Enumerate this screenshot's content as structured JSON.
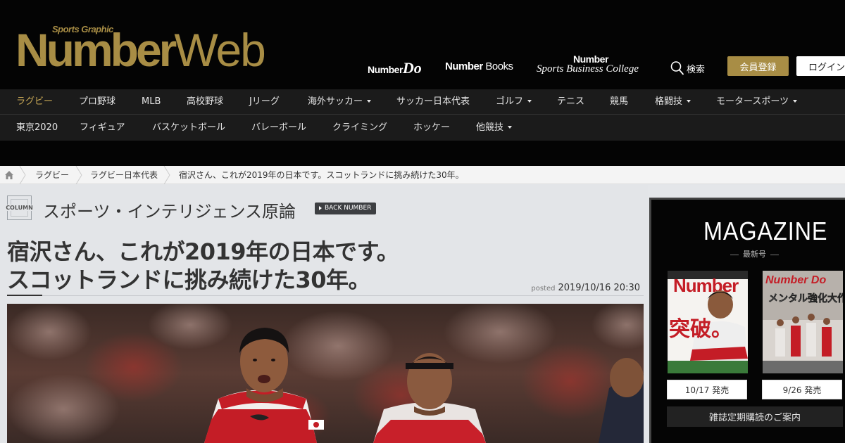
{
  "site": {
    "logo_top": "Sports Graphic",
    "logo_number": "Number",
    "logo_web": "Web"
  },
  "header": {
    "sub_links": [
      {
        "prefix": "Number",
        "suffix": "Do"
      },
      {
        "prefix": "Number",
        "suffix": " Books"
      },
      {
        "prefix": "Number",
        "suffix": "Sports Business College"
      }
    ],
    "search_label": "検索",
    "member_button": "会員登録",
    "login_button": "ログイン",
    "accent_color": "#a88d45"
  },
  "nav": {
    "row1": [
      "ラグビー",
      "プロ野球",
      "MLB",
      "高校野球",
      "Jリーグ",
      "海外サッカー",
      "サッカー日本代表",
      "ゴルフ",
      "テニス",
      "競馬",
      "格闘技",
      "モータースポーツ"
    ],
    "row2": [
      "東京2020",
      "フィギュア",
      "バスケットボール",
      "バレーボール",
      "クライミング",
      "ホッケー",
      "他競技"
    ],
    "active": "ラグビー"
  },
  "breadcrumb": {
    "items": [
      "ラグビー",
      "ラグビー日本代表",
      "宿沢さん、これが2019年の日本です。スコットランドに挑み続けた30年。"
    ]
  },
  "article": {
    "column_badge": "COLUMN",
    "column_title": "スポーツ・インテリジェンス原論",
    "back_number": "BACK NUMBER",
    "headline_line1": "宿沢さん、これが2019年の日本です。",
    "headline_line2": "スコットランドに挑み続けた30年。",
    "posted_label": "posted",
    "posted_date": "2019/10/16 20:30"
  },
  "magazine": {
    "title": "MAGAZINE",
    "subtitle": "最新号",
    "covers": [
      {
        "brand": "Number",
        "headline": "突破。",
        "release": "10/17 発売"
      },
      {
        "brand": "Number Do",
        "headline": "メンタル強化大作戦",
        "release": "9/26 発売"
      }
    ],
    "subscribe": "雑誌定期購読のご案内"
  }
}
